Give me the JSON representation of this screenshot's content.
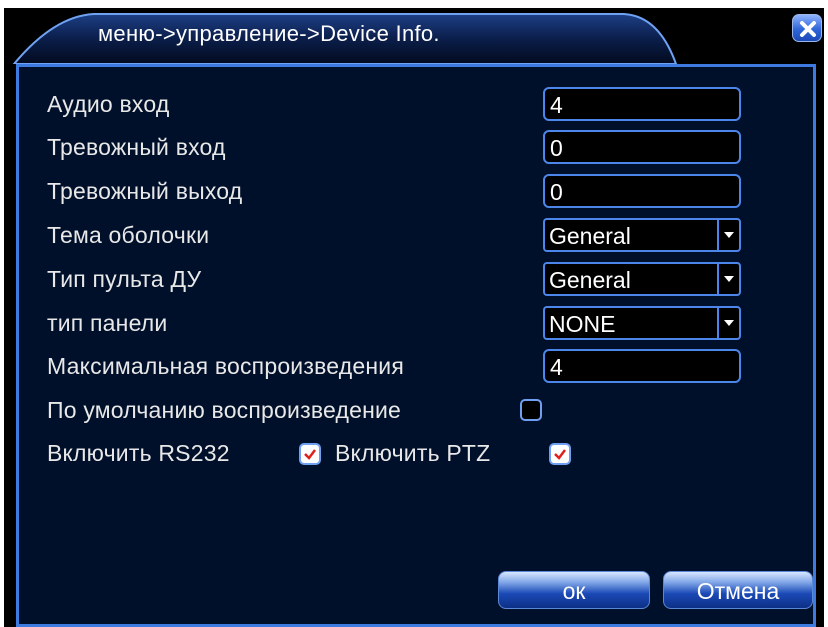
{
  "window": {
    "breadcrumb": "меню->управление->Device Info.",
    "close_icon": "close-icon"
  },
  "fields": {
    "audio_in": {
      "label": "Аудио вход",
      "value": "4"
    },
    "alarm_in": {
      "label": "Тревожный вход",
      "value": "0"
    },
    "alarm_out": {
      "label": "Тревожный выход",
      "value": "0"
    },
    "theme": {
      "label": "Тема оболочки",
      "value": "General"
    },
    "remote_type": {
      "label": "Тип пульта ДУ",
      "value": "General"
    },
    "panel_type": {
      "label": "тип панели",
      "value": "NONE"
    },
    "max_playback": {
      "label": "Максимальная воспроизведения",
      "value": "4"
    },
    "default_playback": {
      "label": "По умолчанию воспроизведение",
      "checked": false
    },
    "enable_rs232": {
      "label": "Включить RS232",
      "checked": true
    },
    "enable_ptz": {
      "label": "Включить PTZ",
      "checked": true
    }
  },
  "buttons": {
    "ok": "ок",
    "cancel": "Отмена"
  },
  "colors": {
    "panel_border": "#3d7be0",
    "panel_bg": "#01102a",
    "check_mark": "#e0201c"
  }
}
